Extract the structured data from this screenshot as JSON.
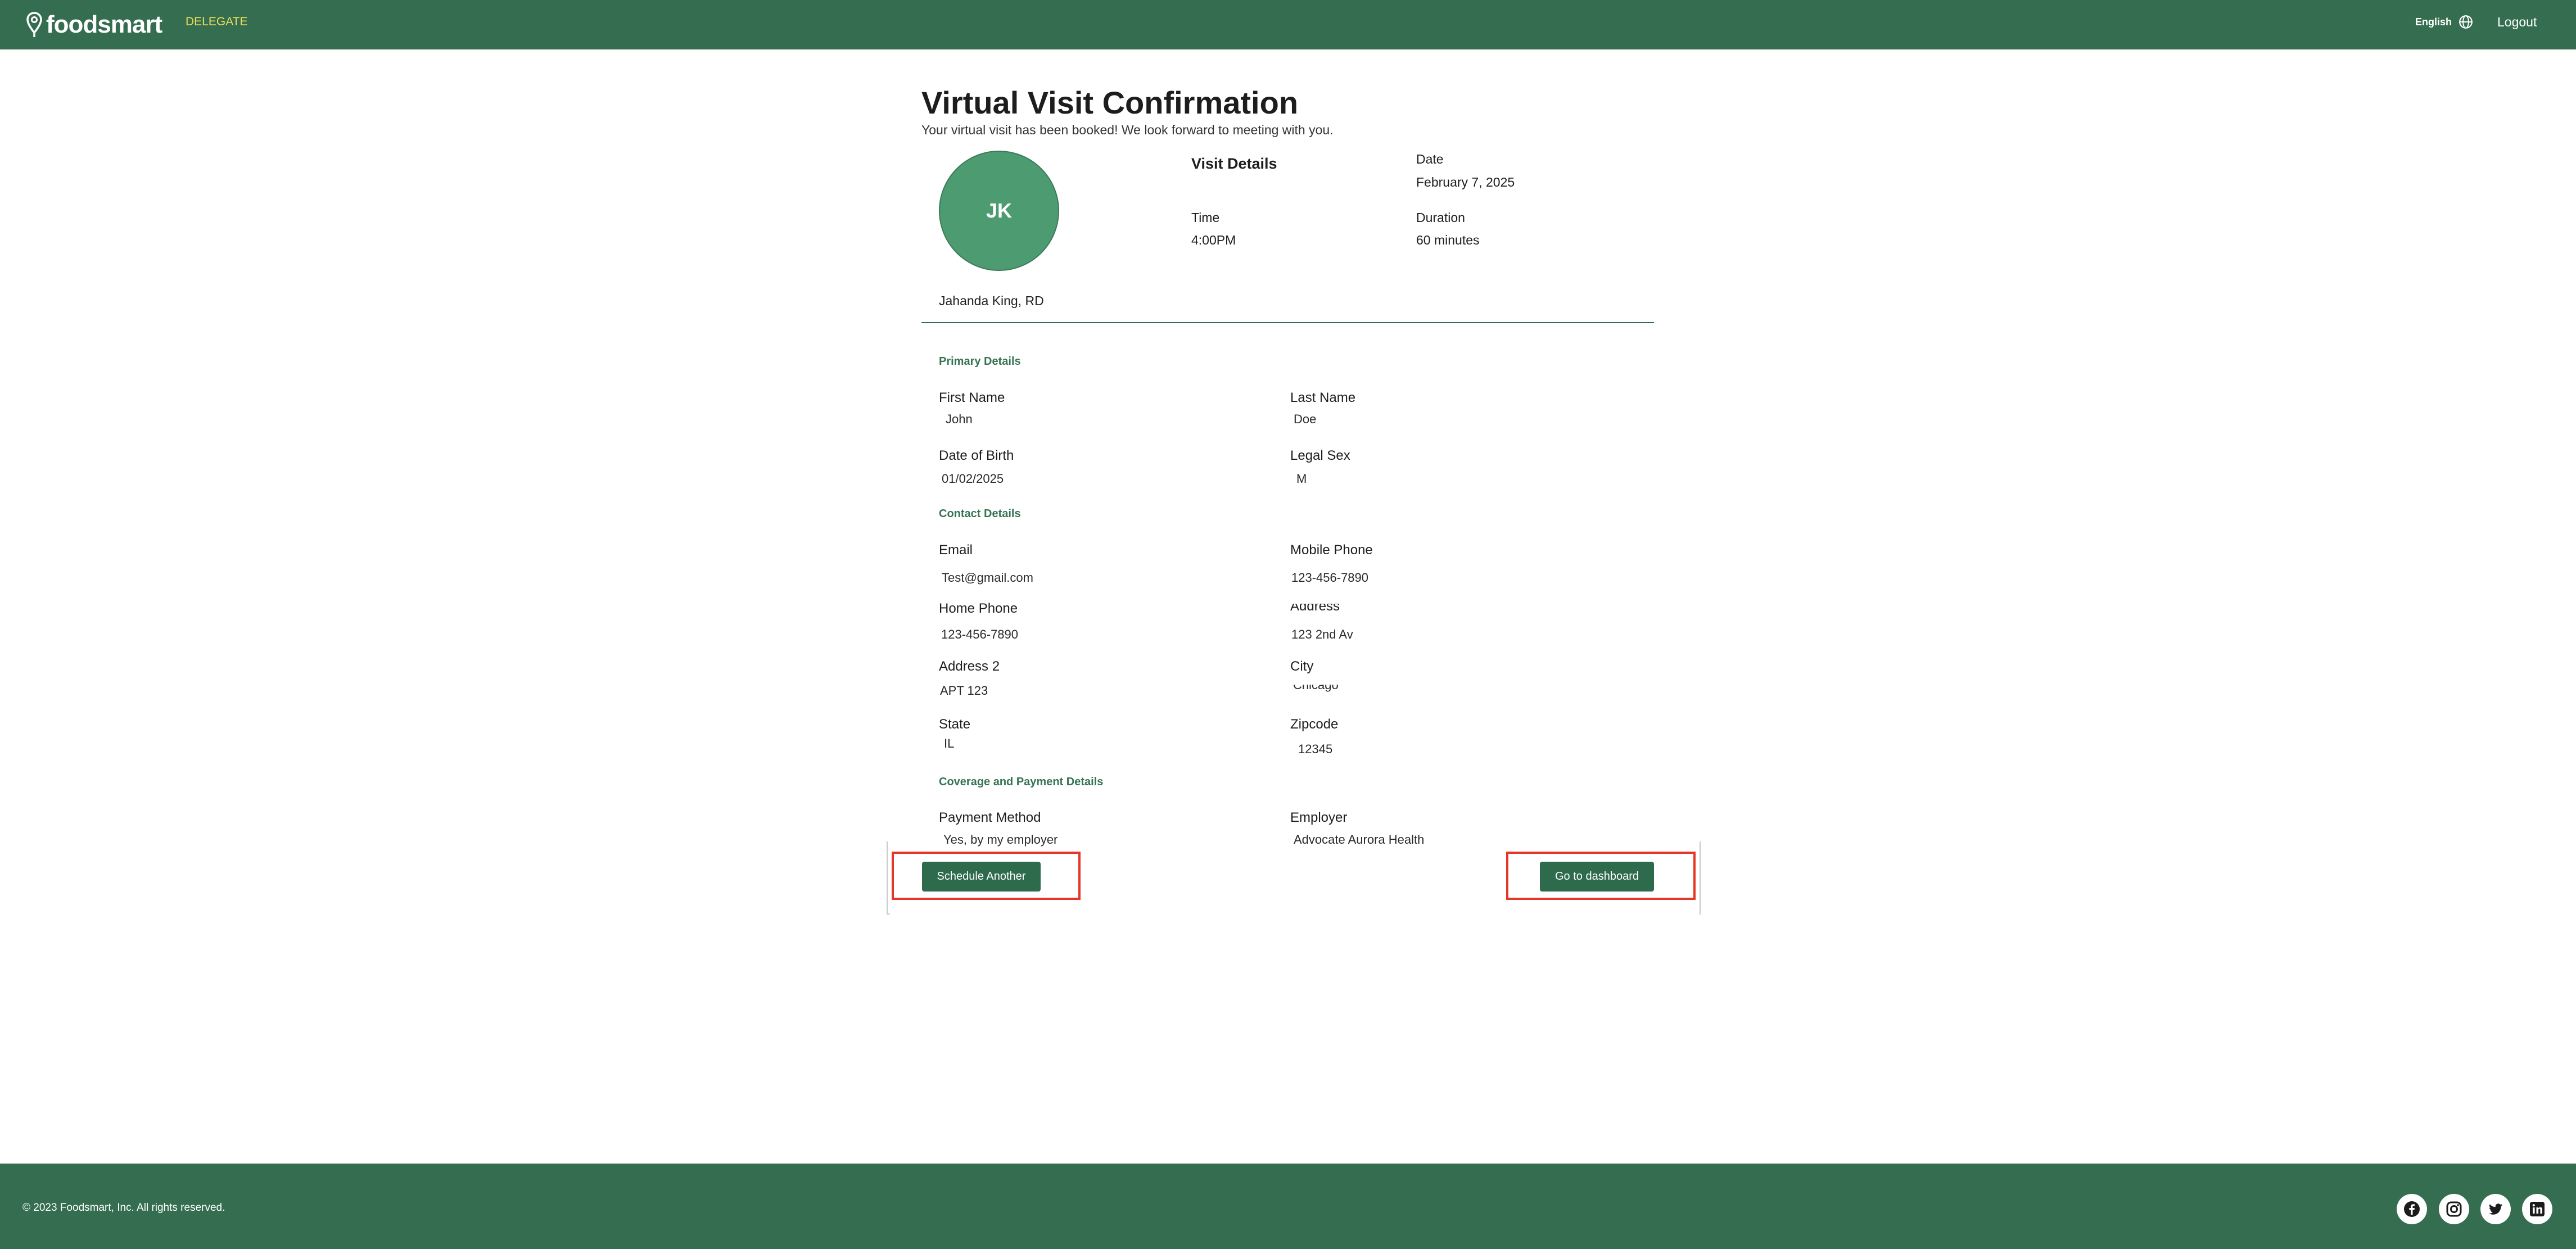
{
  "header": {
    "logo_text": "foodsmart",
    "nav_link": "DELEGATE",
    "language": "English",
    "language_icon": "globe-icon",
    "logout": "Logout"
  },
  "page": {
    "title": "Virtual Visit Confirmation",
    "subtitle": "Your virtual visit has been booked! We look forward to meeting with you."
  },
  "provider": {
    "initials": "JK",
    "name": "Jahanda King, RD"
  },
  "visit": {
    "title": "Visit Details",
    "date_label": "Date",
    "date_value": "February 7, 2025",
    "time_label": "Time",
    "time_value": "4:00PM",
    "duration_label": "Duration",
    "duration_value": "60 minutes"
  },
  "primary": {
    "title": "Primary Details",
    "first_name_label": "First Name",
    "first_name": "John",
    "last_name_label": "Last Name",
    "last_name": "Doe",
    "dob_label": "Date of Birth",
    "dob": "01/02/2025",
    "sex_label": "Legal Sex",
    "sex": "M"
  },
  "contact": {
    "title": "Contact Details",
    "email_label": "Email",
    "email": "Test@gmail.com",
    "mobile_label": "Mobile Phone",
    "mobile": "123-456-7890",
    "home_label": "Home Phone",
    "home": "123-456-7890",
    "address_label": "Address",
    "address": "123 2nd Av",
    "address2_label": "Address 2",
    "address2": "APT 123",
    "city_label": "City",
    "city": "Chicago",
    "state_label": "State",
    "state": "IL",
    "zip_label": "Zipcode",
    "zip": "12345"
  },
  "coverage": {
    "title": "Coverage and Payment Details",
    "payment_label": "Payment Method",
    "payment": "Yes, by my employer",
    "employer_label": "Employer",
    "employer": "Advocate Aurora Health"
  },
  "actions": {
    "schedule": "Schedule Another",
    "dashboard": "Go to dashboard"
  },
  "footer": {
    "copyright": "© 2023 Foodsmart, Inc. All rights reserved.",
    "social": [
      "facebook-icon",
      "instagram-icon",
      "twitter-icon",
      "linkedin-icon"
    ]
  },
  "colors": {
    "brand_green": "#346d4f",
    "avatar_green": "#4d9c71",
    "accent_yellow": "#f0df5a",
    "highlight_red": "#e53727"
  }
}
